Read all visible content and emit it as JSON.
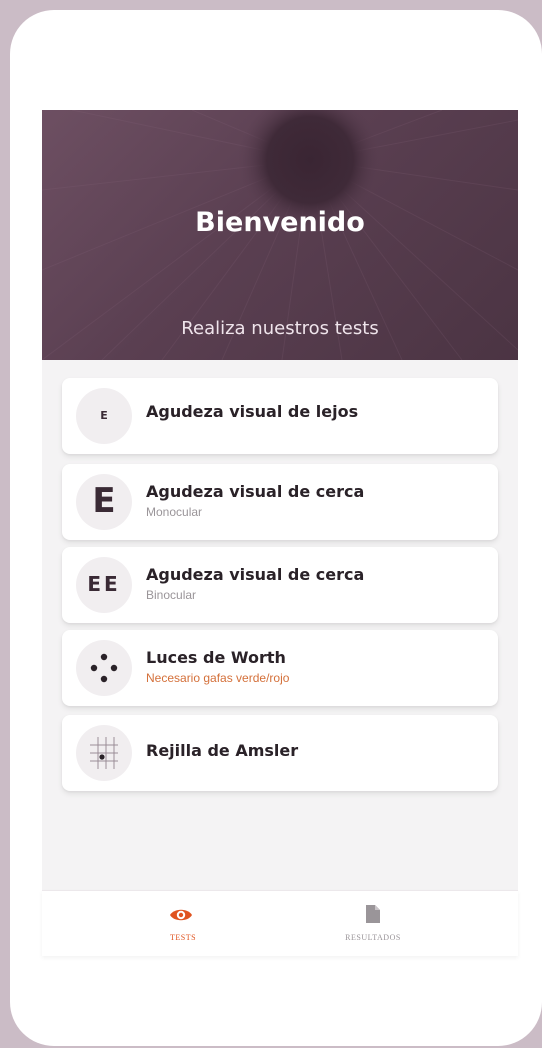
{
  "hero": {
    "title": "Bienvenido",
    "subtitle": "Realiza nuestros tests"
  },
  "tests": [
    {
      "icon": "e-small-icon",
      "letters": "E",
      "title": "Agudeza visual de lejos",
      "subtitle": ""
    },
    {
      "icon": "e-large-icon",
      "letters": "E",
      "title": "Agudeza visual de cerca",
      "subtitle": "Monocular"
    },
    {
      "icon": "ee-icon",
      "letters": "EE",
      "title": "Agudeza visual de cerca",
      "subtitle": "Binocular"
    },
    {
      "icon": "worth-dots-icon",
      "title": "Luces de Worth",
      "subtitle": "Necesario gafas verde/rojo"
    },
    {
      "icon": "amsler-grid-icon",
      "title": "Rejilla de Amsler",
      "subtitle": ""
    }
  ],
  "nav": {
    "tests_label": "TESTS",
    "results_label": "RESULTADOS",
    "active": "tests"
  },
  "colors": {
    "accent": "#e0531f",
    "warning_text": "#d4703a",
    "hero_bg": "#5a3f51",
    "inactive": "#9a9599"
  }
}
